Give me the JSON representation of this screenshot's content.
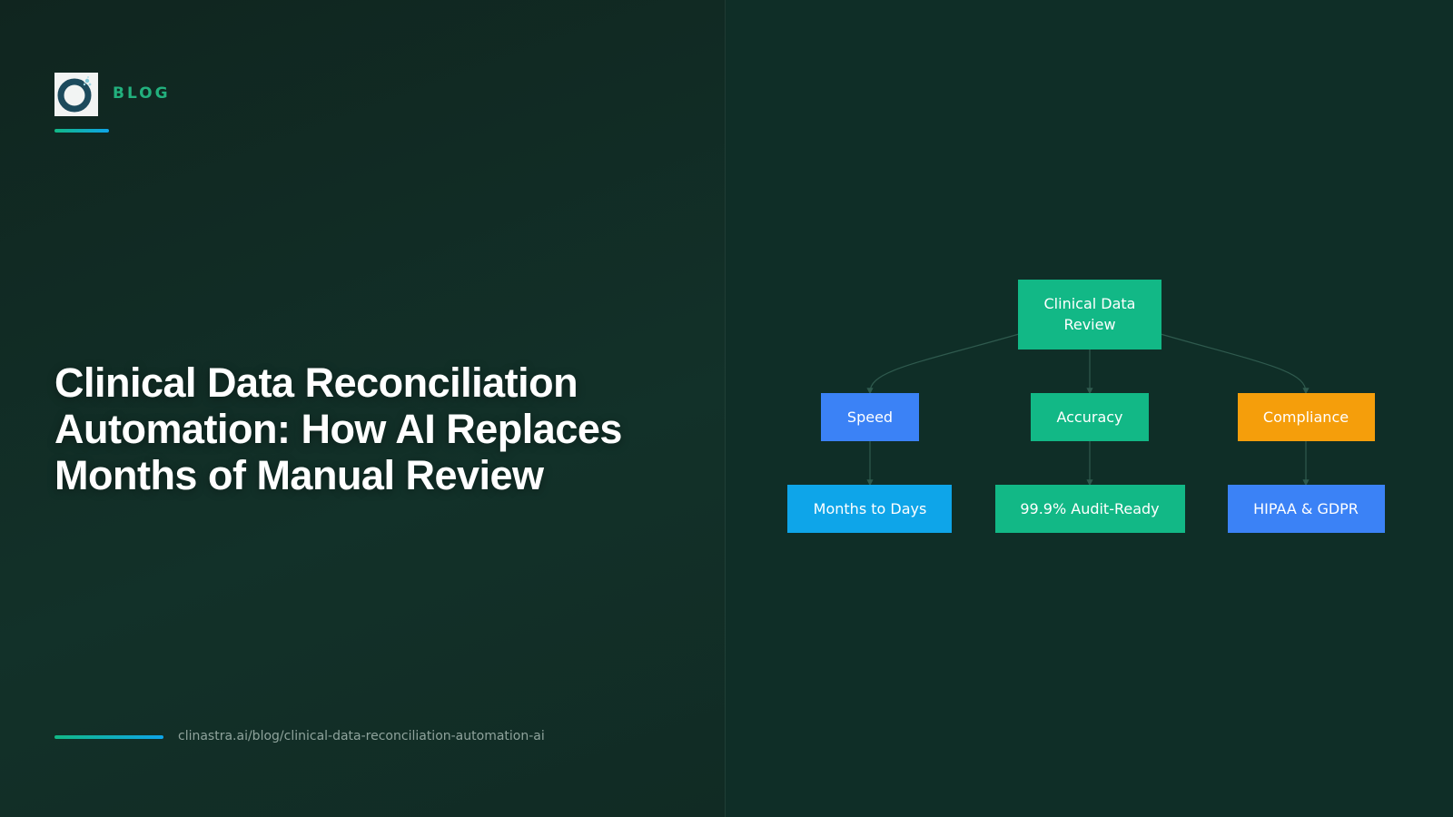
{
  "header": {
    "label": "BLOG",
    "logo_icon": "clinastra-logo-icon"
  },
  "headline": "Clinical Data Reconciliation Automation: How AI Replaces Months of Manual Review",
  "footer": {
    "url": "clinastra.ai/blog/clinical-data-reconciliation-automation-ai"
  },
  "colors": {
    "background": "#10251f",
    "accent_green": "#12b886",
    "accent_blue": "#3b82f6",
    "accent_cyan": "#0ea5e9",
    "accent_orange": "#f59e0b"
  },
  "diagram": {
    "root": {
      "label_lines": [
        "Clinical Data",
        "Review"
      ],
      "color": "#12b886"
    },
    "branches": [
      {
        "label": "Speed",
        "color": "#3b82f6",
        "child": {
          "label": "Months to Days",
          "color": "#0ea5e9"
        }
      },
      {
        "label": "Accuracy",
        "color": "#12b886",
        "child": {
          "label": "99.9% Audit-Ready",
          "color": "#12b886"
        }
      },
      {
        "label": "Compliance",
        "color": "#f59e0b",
        "child": {
          "label": "HIPAA & GDPR",
          "color": "#3b82f6"
        }
      }
    ]
  }
}
